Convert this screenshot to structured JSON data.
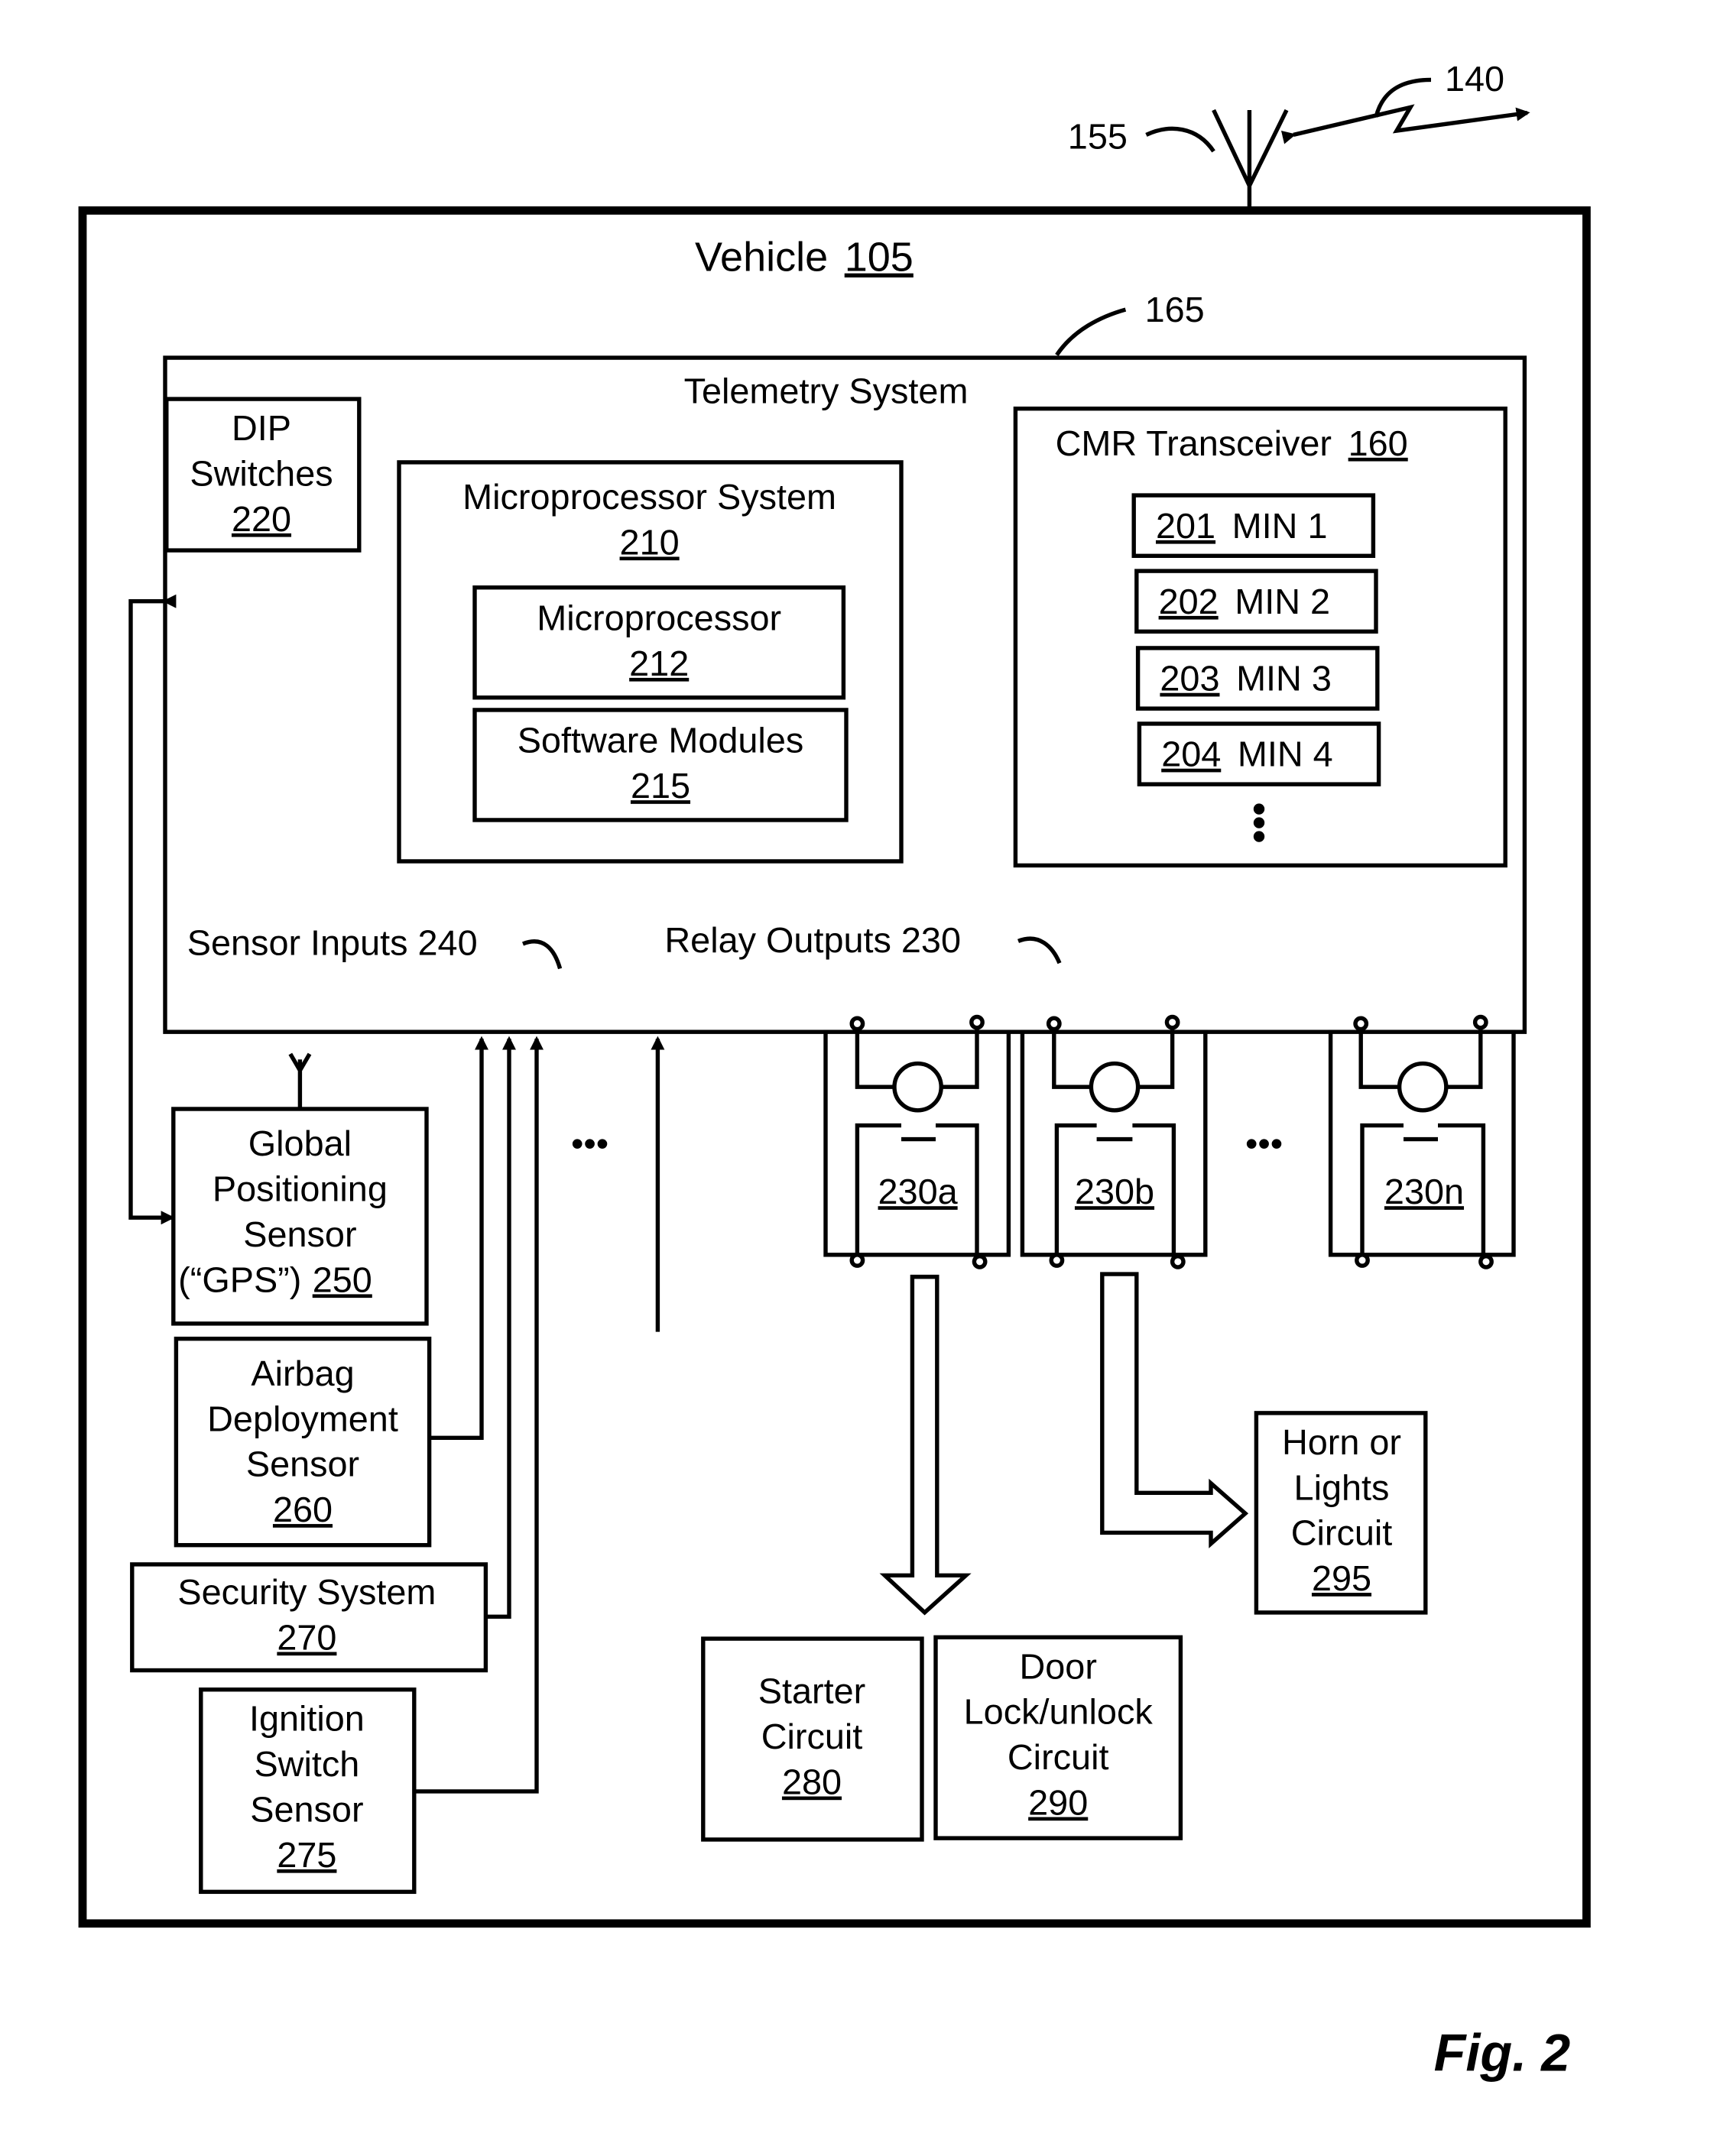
{
  "figure": {
    "label": "Fig. 2",
    "refs": {
      "antenna": "155",
      "wireless_link": "140",
      "telemetry_ref": "165"
    }
  },
  "vehicle": {
    "title": "Vehicle",
    "num": "105"
  },
  "telemetry": {
    "title": "Telemetry System"
  },
  "dip": {
    "l1": "DIP",
    "l2": "Switches",
    "num": "220"
  },
  "microsystem": {
    "title": "Microprocessor System",
    "num": "210"
  },
  "microprocessor": {
    "title": "Microprocessor",
    "num": "212"
  },
  "software": {
    "title": "Software Modules",
    "num": "215"
  },
  "cmr": {
    "title": "CMR Transceiver",
    "num": "160",
    "mins": [
      {
        "num": "201",
        "label": "MIN 1"
      },
      {
        "num": "202",
        "label": "MIN 2"
      },
      {
        "num": "203",
        "label": "MIN 3"
      },
      {
        "num": "204",
        "label": "MIN 4"
      }
    ]
  },
  "sensor_inputs": "Sensor Inputs 240",
  "relay_outputs": "Relay Outputs 230",
  "relays": [
    "230a",
    "230b",
    "230n"
  ],
  "ellipsis": "•••",
  "gps": {
    "l1": "Global",
    "l2": "Positioning",
    "l3": "Sensor",
    "l4": "(“GPS”)",
    "num": "250"
  },
  "airbag": {
    "l1": "Airbag",
    "l2": "Deployment",
    "l3": "Sensor",
    "num": "260"
  },
  "security": {
    "l1": "Security System",
    "num": "270"
  },
  "ignition": {
    "l1": "Ignition",
    "l2": "Switch",
    "l3": "Sensor",
    "num": "275"
  },
  "starter": {
    "l1": "Starter",
    "l2": "Circuit",
    "num": "280"
  },
  "door": {
    "l1": "Door",
    "l2": "Lock/unlock",
    "l3": "Circuit",
    "num": "290"
  },
  "horn": {
    "l1": "Horn or",
    "l2": "Lights",
    "l3": "Circuit",
    "num": "295"
  }
}
